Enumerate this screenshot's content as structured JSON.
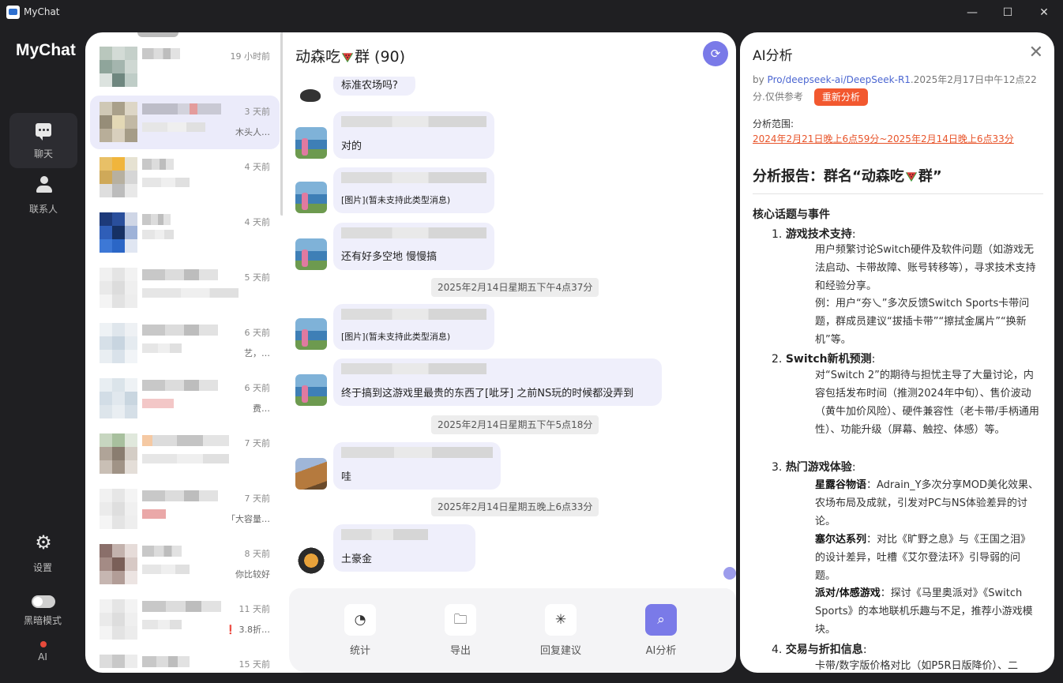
{
  "window": {
    "title": "MyChat",
    "minimize": "—",
    "maximize": "☐",
    "close": "✕"
  },
  "sidebar": {
    "brand": "MyChat",
    "items": [
      {
        "label": "聊天",
        "icon": "chat-icon"
      },
      {
        "label": "联系人",
        "icon": "contacts-icon"
      }
    ],
    "settings_label": "设置",
    "dark_mode_label": "黑暗模式",
    "ai_label": "AI"
  },
  "conversations": [
    {
      "time": "19 小时前",
      "snippet": ""
    },
    {
      "time": "3 天前",
      "snippet": "木头人…"
    },
    {
      "time": "4 天前",
      "snippet": ""
    },
    {
      "time": "4 天前",
      "snippet": ""
    },
    {
      "time": "5 天前",
      "snippet": ""
    },
    {
      "time": "6 天前",
      "snippet": "艺，…"
    },
    {
      "time": "6 天前",
      "snippet": "费…"
    },
    {
      "time": "7 天前",
      "snippet": ""
    },
    {
      "time": "7 天前",
      "snippet": "「大容量…"
    },
    {
      "time": "8 天前",
      "snippet": "你比较好"
    },
    {
      "time": "11 天前",
      "snippet": "❗ 3.8折…"
    },
    {
      "time": "15 天前",
      "snippet": ""
    }
  ],
  "chat": {
    "title_prefix": "动森吃",
    "title_suffix": "群 (90)",
    "refresh_icon": "refresh-icon",
    "messages": [
      {
        "text": "标准农场吗?"
      },
      {
        "text": "对的"
      },
      {
        "text": "[图片](暂未支持此类型消息)"
      },
      {
        "text": "还有好多空地 慢慢搞"
      },
      {
        "text": "[图片](暂未支持此类型消息)"
      },
      {
        "text": "终于搞到这游戏里最贵的东西了[呲牙] 之前NS玩的时候都没弄到"
      },
      {
        "text": "哇"
      },
      {
        "text": "土豪金"
      }
    ],
    "timestamps": [
      "2025年2月14日星期五下午4点37分",
      "2025年2月14日星期五下午5点18分",
      "2025年2月14日星期五晚上6点33分"
    ],
    "toolbar": [
      {
        "label": "统计",
        "icon": "pie-chart-icon"
      },
      {
        "label": "导出",
        "icon": "export-folder-icon"
      },
      {
        "label": "回复建议",
        "icon": "loading-spinner-icon"
      },
      {
        "label": "AI分析",
        "icon": "ai-search-icon"
      }
    ]
  },
  "ai_panel": {
    "title": "AI分析",
    "meta_prefix": "by ",
    "model": "Pro/deepseek-ai/DeepSeek-R1",
    "meta_suffix": ".2025年2月17日中午12点22分.仅供参考",
    "reanalyze_label": "重新分析",
    "range_label": "分析范围:",
    "range_value": "2024年2月21日晚上6点59分~2025年2月14日晚上6点33分",
    "report_title_prefix": "分析报告：群名“动森吃",
    "report_title_suffix": "群”",
    "section_title": "核心话题与事件",
    "items": [
      {
        "num": "1.",
        "title": "游戏技术支持",
        "colon": ":"
      },
      {
        "num": "2.",
        "title": "Switch新机预测",
        "colon": ":"
      },
      {
        "num": "3.",
        "title": "热门游戏体验",
        "colon": ":"
      },
      {
        "num": "4.",
        "title": "交易与折扣信息",
        "colon": ":"
      }
    ],
    "p1": "用户频繁讨论Switch硬件及软件问题（如游戏无法启动、卡带故障、账号转移等），寻求技术支持和经验分享。",
    "p2": "例：用户“夯乀”多次反馈Switch Sports卡带问题，群成员建议“拔插卡带”“擦拭金属片”“换新机”等。",
    "p3": "对“Switch 2”的期待与担忧主导了大量讨论，内容包括发布时间（推测2024年中旬）、售价波动（黄牛加价风险）、硬件兼容性（老卡带/手柄通用性）、功能升级（屏幕、触控、体感）等。",
    "g1_title": "星露谷物语",
    "g1_text": "：Adrain_Y多次分享MOD美化效果、农场布局及成就，引发对PC与NS体验差异的讨论。",
    "g2_title": "塞尔达系列",
    "g2_text": "：对比《旷野之息》与《王国之泪》的设计差异，吐槽《艾尔登法环》引导弱的问题。",
    "g3_title": "派对/体感游戏",
    "g3_text": "：探讨《马里奥派对》《Switch Sports》的本地联机乐趣与不足，推荐小游戏模块。",
    "p4": "卡带/数字版价格对比（如P5R日版降价）、二"
  },
  "colors": {
    "accent": "#7a7ae8",
    "orange": "#f2582f",
    "selected": "#ebebfa"
  }
}
